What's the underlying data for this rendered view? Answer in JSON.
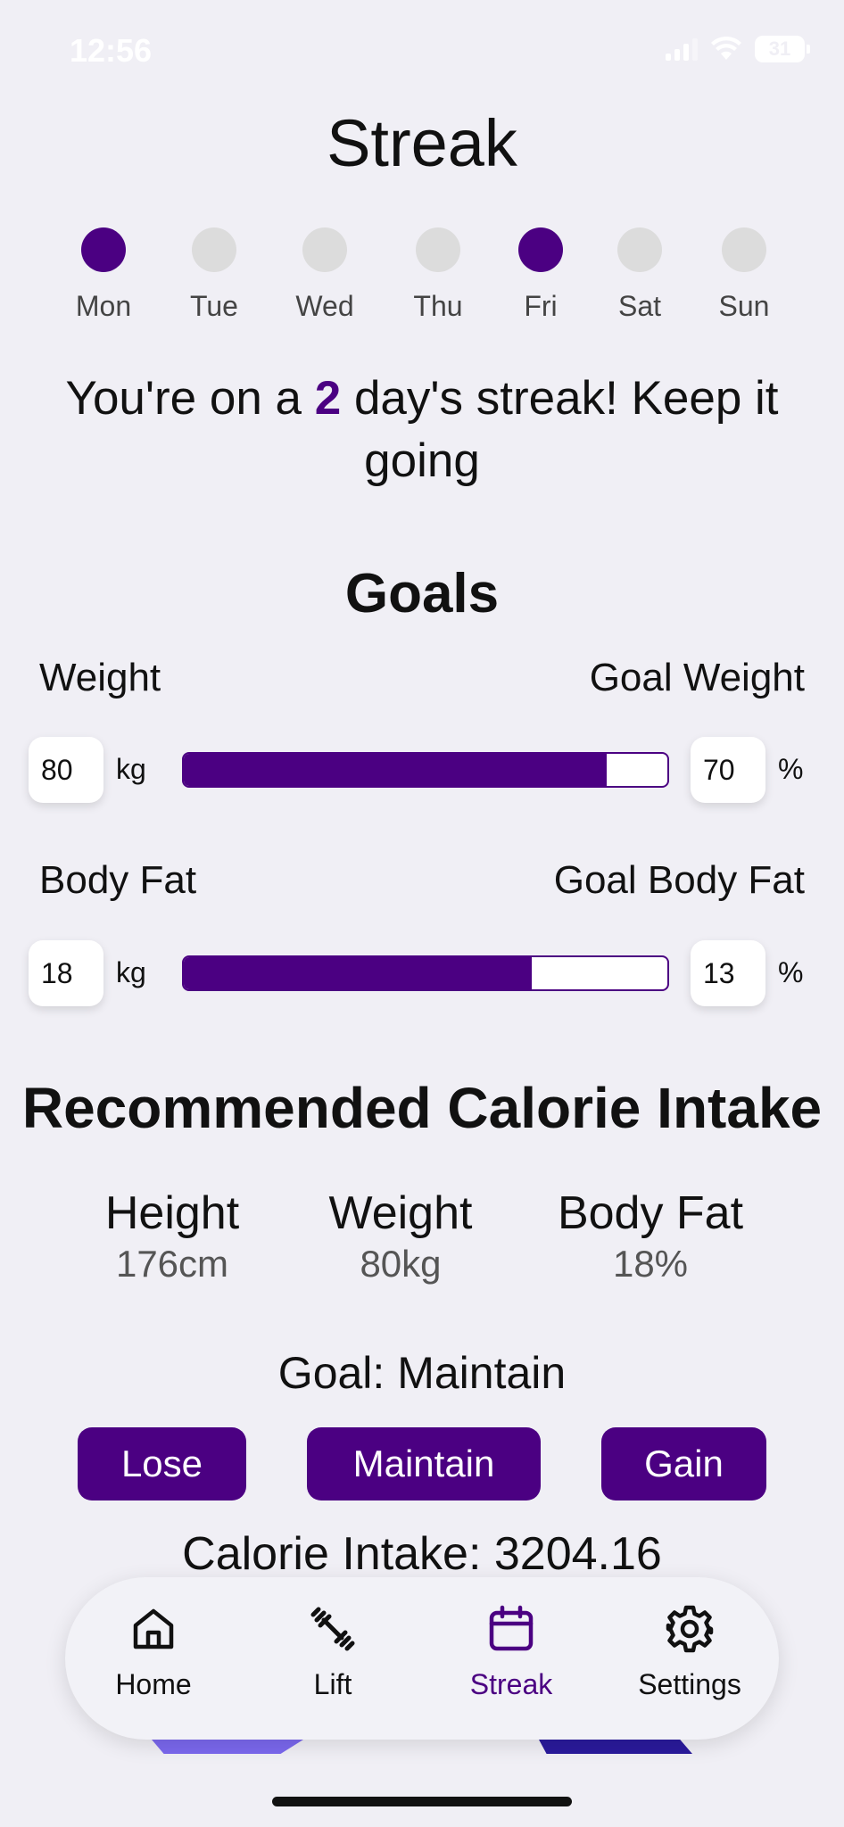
{
  "status_bar": {
    "time": "12:56",
    "battery": "31"
  },
  "header": {
    "title": "Streak"
  },
  "week": {
    "days": [
      {
        "label": "Mon",
        "active": true
      },
      {
        "label": "Tue",
        "active": false
      },
      {
        "label": "Wed",
        "active": false
      },
      {
        "label": "Thu",
        "active": false
      },
      {
        "label": "Fri",
        "active": true
      },
      {
        "label": "Sat",
        "active": false
      },
      {
        "label": "Sun",
        "active": false
      }
    ]
  },
  "streak": {
    "prefix": "You're on a ",
    "count": "2",
    "suffix": " day's streak! Keep it going"
  },
  "goals": {
    "title": "Goals",
    "weight": {
      "left_label": "Weight",
      "right_label": "Goal Weight",
      "current_value": "80",
      "current_unit": "kg",
      "goal_value": "70",
      "goal_unit": "%",
      "progress_fraction": 0.875
    },
    "body_fat": {
      "left_label": "Body Fat",
      "right_label": "Goal Body Fat",
      "current_value": "18",
      "current_unit": "kg",
      "goal_value": "13",
      "goal_unit": "%",
      "progress_fraction": 0.72
    }
  },
  "calorie": {
    "title": "Recommended Calorie Intake",
    "stats": [
      {
        "label": "Height",
        "value": "176cm"
      },
      {
        "label": "Weight",
        "value": "80kg"
      },
      {
        "label": "Body Fat",
        "value": "18%"
      }
    ],
    "goal_text": "Goal: Maintain",
    "buttons": {
      "lose": "Lose",
      "maintain": "Maintain",
      "gain": "Gain"
    },
    "intake_text": "Calorie Intake: 3204.16"
  },
  "tab_bar": {
    "tabs": [
      {
        "label": "Home",
        "icon": "home-icon"
      },
      {
        "label": "Lift",
        "icon": "dumbbell-icon"
      },
      {
        "label": "Streak",
        "icon": "calendar-icon",
        "active": true
      },
      {
        "label": "Settings",
        "icon": "gear-icon"
      }
    ]
  },
  "colors": {
    "accent": "#4b0082",
    "background": "#f0eff5",
    "inactive_dot": "#dcdcdc"
  }
}
